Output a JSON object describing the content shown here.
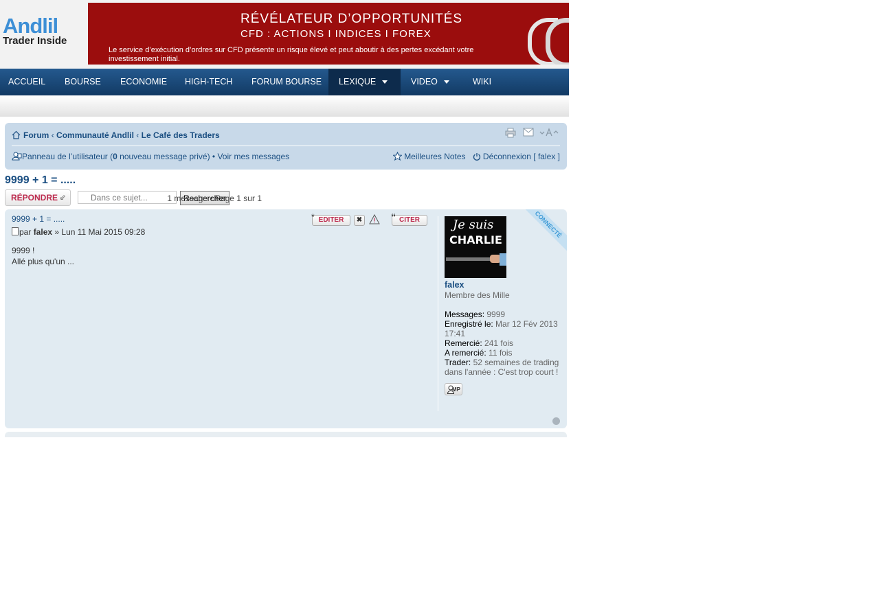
{
  "logo": {
    "line1": "Andlil",
    "line2": "Trader Inside"
  },
  "banner": {
    "headline": "RÉVÉLATEUR D’OPPORTUNITÉS",
    "subline": "CFD : ACTIONS I INDICES I FOREX",
    "disclaimer": "Le service d’exécution d’ordres sur CFD présente un risque élevé et peut aboutir à des pertes excédant votre investissement initial.",
    "brand": "IG"
  },
  "nav": {
    "items": [
      {
        "label": "ACCUEIL"
      },
      {
        "label": "BOURSE"
      },
      {
        "label": "ECONOMIE"
      },
      {
        "label": "HIGH-TECH"
      },
      {
        "label": "FORUM BOURSE"
      },
      {
        "label": "LEXIQUE"
      },
      {
        "label": "VIDEO"
      },
      {
        "label": "WIKI"
      }
    ]
  },
  "breadcrumb": {
    "items": [
      "Forum",
      "Communauté Andlil",
      "Le Café des Traders"
    ],
    "sep": "‹"
  },
  "ucp": {
    "panel_label": "Panneau de l’utilisateur",
    "pm_count": "0",
    "pm_text": "nouveau message privé",
    "view_messages": "Voir mes messages",
    "best_notes": "Meilleures Notes",
    "logout": "Déconnexion [ falex ]"
  },
  "topic": {
    "title": "9999 + 1 = .....",
    "reply_label": "RÉPONDRE",
    "search_placeholder": "Dans ce sujet...",
    "search_button": "Rechercher",
    "pagination": "1 message • Page 1 sur 1"
  },
  "post": {
    "title": "9999 + 1 = .....",
    "by": "par",
    "author": "falex",
    "date": "» Lun 11 Mai 2015 09:28",
    "body_line1": "9999 !",
    "body_line2": "Allé plus qu'un ...",
    "edit_label": "EDITER",
    "quote_label": "CITER",
    "online_label": "CONNECTÉ"
  },
  "profile": {
    "avatar_line1": "Je suis",
    "avatar_line2": "CHARLIE",
    "username": "falex",
    "rank": "Membre des Mille",
    "messages_label": "Messages:",
    "messages_value": "9999",
    "registered_label": "Enregistré le:",
    "registered_value": "Mar 12 Fév 2013 17:41",
    "thanked_label": "Remercié:",
    "thanked_value": "241 fois",
    "has_thanked_label": "A remercié:",
    "has_thanked_value": "11 fois",
    "trader_label": "Trader:",
    "trader_value": "52 semaines de trading dans l'année : C'est trop court !",
    "pm_button": "MP"
  },
  "colors": {
    "nav_bg": "#1b4a78",
    "link": "#1b4f82",
    "post_bg": "#e1ebf2",
    "navbox_bg": "#c8d9e9",
    "accent_red": "#bc2a4d"
  }
}
